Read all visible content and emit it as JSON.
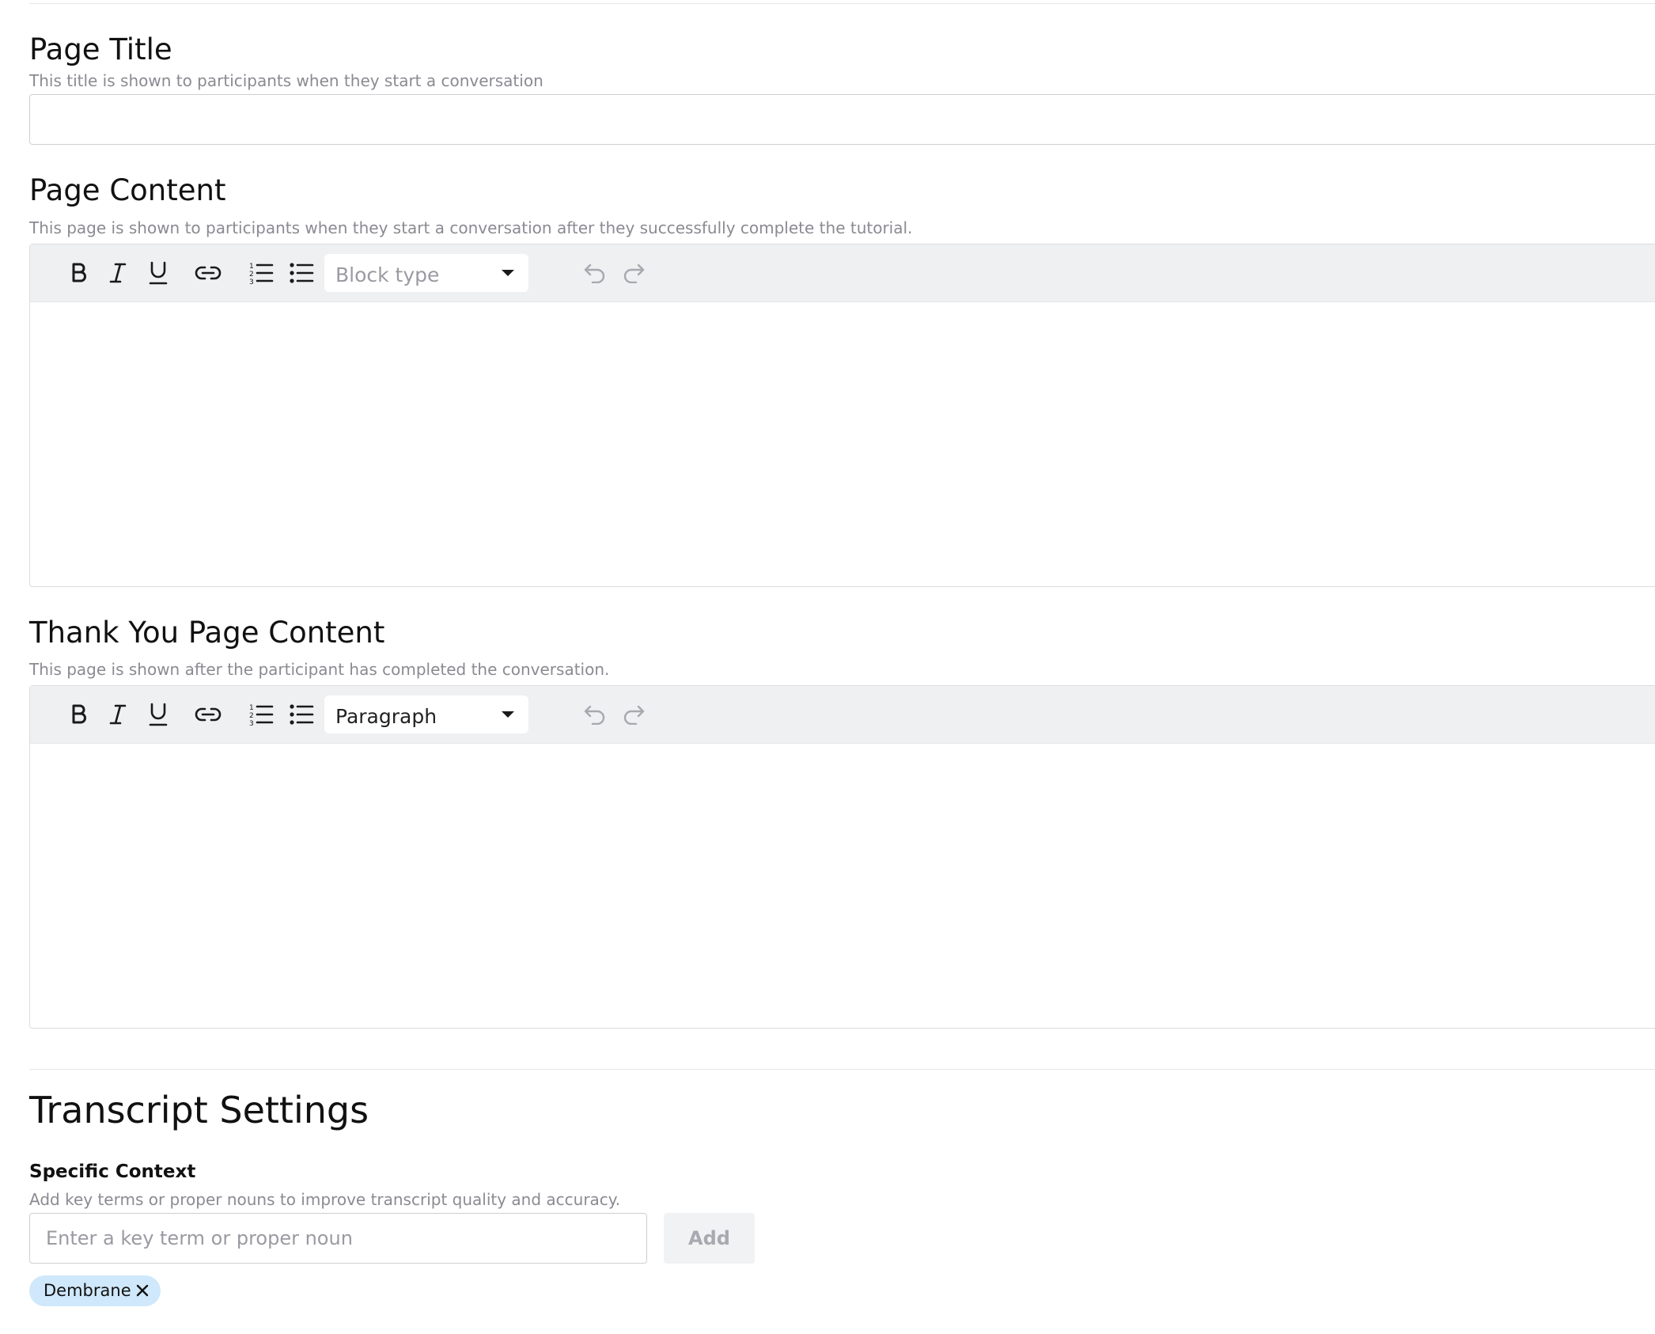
{
  "page_title_section": {
    "title": "Page Title",
    "helper": "This title is shown to participants when they start a conversation",
    "value": ""
  },
  "page_content_section": {
    "title": "Page Content",
    "helper": "This page is shown to participants when they start a conversation after they successfully complete the tutorial.",
    "block_type": "Block type",
    "content": ""
  },
  "thank_you_section": {
    "title": "Thank You Page Content",
    "helper": "This page is shown after the participant has completed the conversation.",
    "block_type": "Paragraph",
    "content": ""
  },
  "transcript_settings": {
    "title": "Transcript Settings",
    "specific_context": {
      "label": "Specific Context",
      "helper": "Add key terms or proper nouns to improve transcript quality and accuracy.",
      "placeholder": "Enter a key term or proper noun",
      "add_label": "Add",
      "terms": [
        "Dembrane"
      ]
    }
  },
  "toolbar_icons": [
    "bold-icon",
    "italic-icon",
    "underline-icon",
    "link-icon",
    "ordered-list-icon",
    "bullet-list-icon",
    "undo-icon",
    "redo-icon"
  ],
  "colors": {
    "chip_bg": "#cfe8fb",
    "toolbar_bg": "#eff0f2",
    "helper_text": "#8a8a92"
  }
}
